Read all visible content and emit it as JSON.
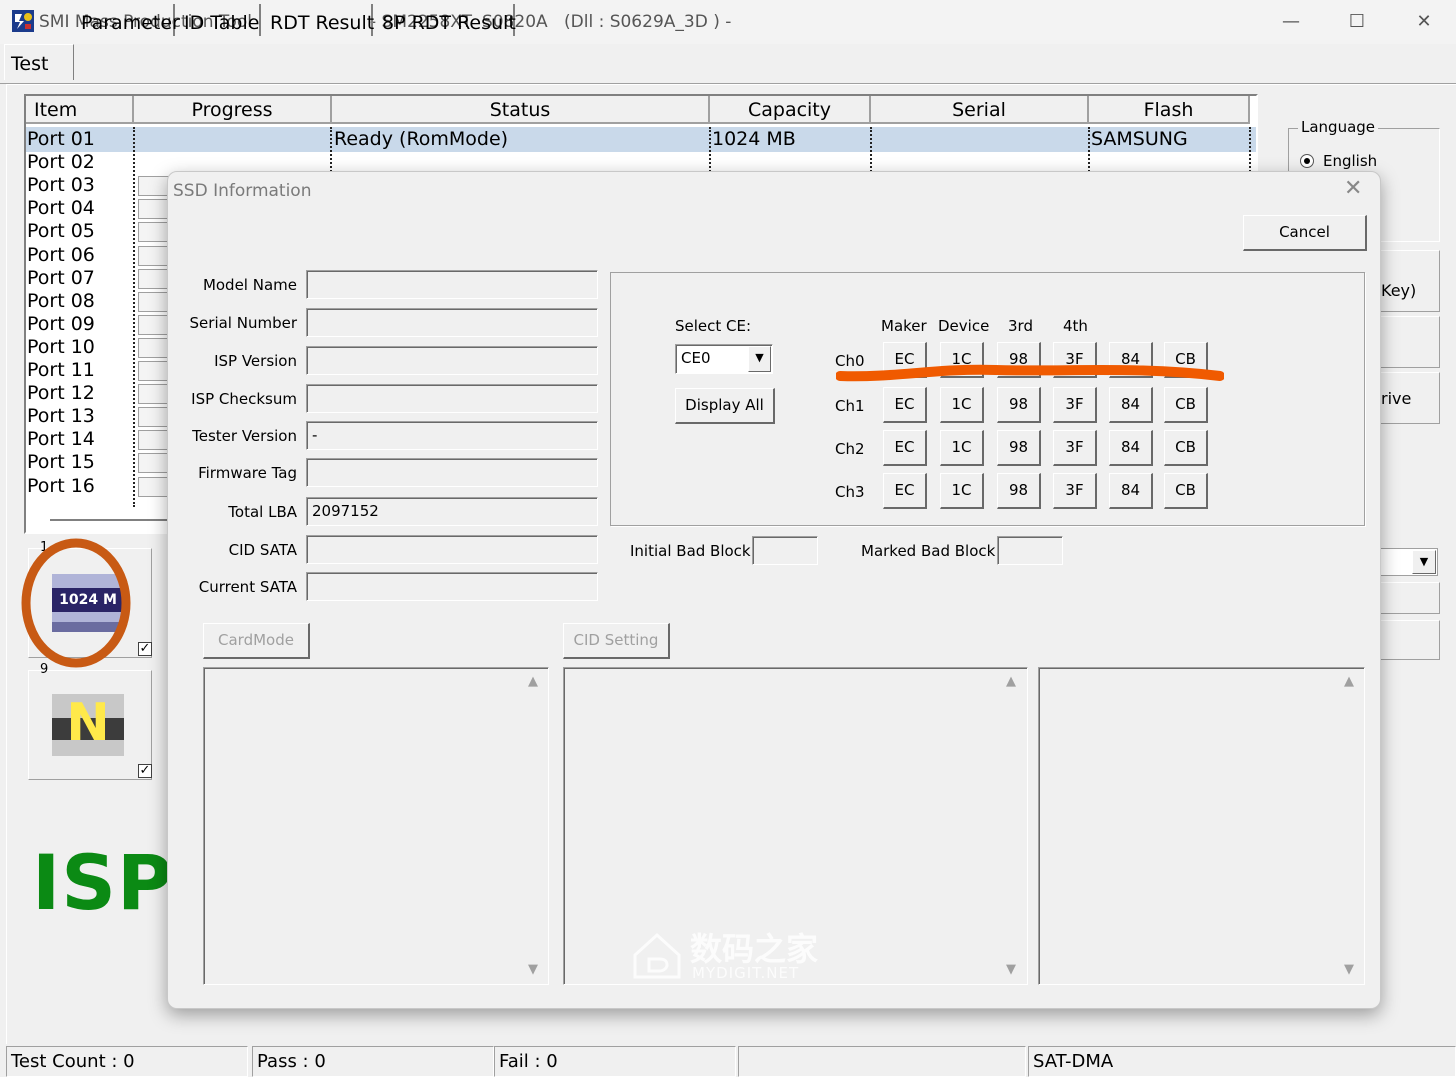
{
  "window": {
    "title": "SMI Mass Production Tool",
    "controller": "- SM2258XT",
    "firmware": "S0820A",
    "dll": "(Dll : S0629A_3D ) -",
    "minimize": "—",
    "maximize": "☐",
    "close": "✕"
  },
  "tabs": [
    "Test",
    "Parameter",
    "ID Table",
    "RDT Result",
    "8P RDT Result"
  ],
  "grid": {
    "columns": [
      "Item",
      "Progress",
      "Status",
      "Capacity",
      "Serial",
      "Flash"
    ],
    "ports": [
      "Port 01",
      "Port 02",
      "Port 03",
      "Port 04",
      "Port 05",
      "Port 06",
      "Port 07",
      "Port 08",
      "Port 09",
      "Port 10",
      "Port 11",
      "Port 12",
      "Port 13",
      "Port 14",
      "Port 15",
      "Port 16"
    ],
    "row1": {
      "status": "Ready (RomMode)",
      "capacity": "1024 MB",
      "serial": "",
      "flash": "SAMSUNG"
    }
  },
  "side": {
    "language_title": "Language",
    "language_option": "English",
    "btn_key_fragment": "Key)",
    "btn_drive_fragment": "rive"
  },
  "thumbs": [
    {
      "index": "1",
      "label": "1024 M",
      "checked": true
    },
    {
      "index": "9",
      "label": "N",
      "checked": true
    }
  ],
  "mode_label": "ISP",
  "status_bar": {
    "test_count": "Test Count : 0",
    "pass": "Pass : 0",
    "fail": "Fail : 0",
    "blank": "",
    "mode": "SAT-DMA"
  },
  "dialog": {
    "title": "SSD Information",
    "close": "✕",
    "cancel": "Cancel",
    "fields": [
      {
        "label": "Model Name",
        "value": ""
      },
      {
        "label": "Serial Number",
        "value": ""
      },
      {
        "label": "ISP Version",
        "value": ""
      },
      {
        "label": "ISP Checksum",
        "value": ""
      },
      {
        "label": "Tester Version",
        "value": "-"
      },
      {
        "label": "Firmware Tag",
        "value": ""
      },
      {
        "label": "Total LBA",
        "value": "2097152"
      },
      {
        "label": "CID SATA",
        "value": ""
      },
      {
        "label": "Current SATA",
        "value": ""
      }
    ],
    "select_ce_label": "Select CE:",
    "select_ce_value": "CE0",
    "display_all": "Display All",
    "id_headers": [
      "Maker",
      "Device",
      "3rd",
      "4th"
    ],
    "channels": [
      {
        "name": "Ch0",
        "bytes": [
          "EC",
          "1C",
          "98",
          "3F",
          "84",
          "CB"
        ]
      },
      {
        "name": "Ch1",
        "bytes": [
          "EC",
          "1C",
          "98",
          "3F",
          "84",
          "CB"
        ]
      },
      {
        "name": "Ch2",
        "bytes": [
          "EC",
          "1C",
          "98",
          "3F",
          "84",
          "CB"
        ]
      },
      {
        "name": "Ch3",
        "bytes": [
          "EC",
          "1C",
          "98",
          "3F",
          "84",
          "CB"
        ]
      }
    ],
    "initial_bad_block_label": "Initial Bad Block",
    "marked_bad_block_label": "Marked Bad Block",
    "card_mode": "CardMode",
    "cid_setting": "CID Setting"
  },
  "watermark": {
    "cn": "数码之家",
    "en": "MYDIGIT.NET"
  },
  "colors": {
    "annotation": "#f05a00",
    "thumb_circle": "#c85a14",
    "isp_green": "#0b8a14",
    "selected_row": "#c9d9ea"
  }
}
